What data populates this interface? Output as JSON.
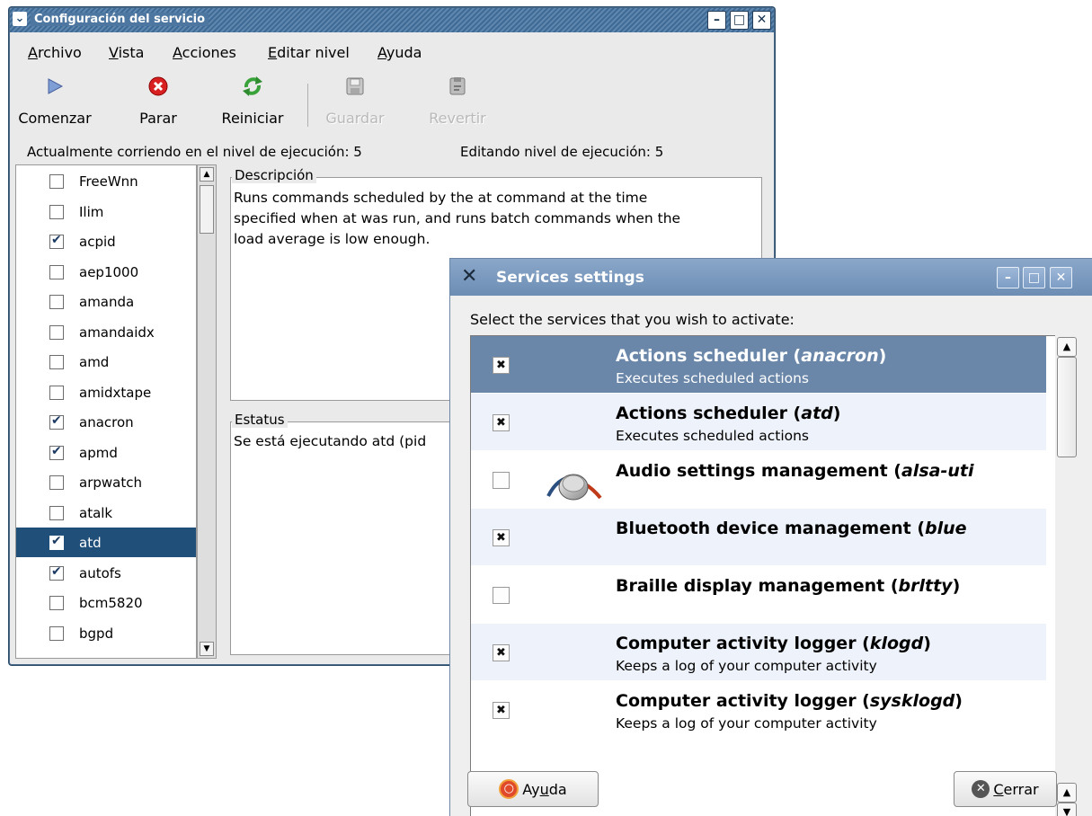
{
  "win1": {
    "title": "Configuración del servicio",
    "menu": [
      {
        "first": "A",
        "rest": "rchivo"
      },
      {
        "first": "V",
        "rest": "ista"
      },
      {
        "first": "A",
        "rest": "cciones"
      },
      {
        "first": "E",
        "rest": "ditar nivel"
      },
      {
        "first": "A",
        "rest": "yuda"
      }
    ],
    "toolbar": {
      "start": "Comenzar",
      "stop": "Parar",
      "restart": "Reiniciar",
      "save": "Guardar",
      "revert": "Revertir"
    },
    "status_current": "Actualmente corriendo en el nivel de ejecución: 5",
    "status_editing": "Editando nivel de ejecución: 5",
    "services": [
      {
        "name": "FreeWnn",
        "checked": false
      },
      {
        "name": "Ilim",
        "checked": false
      },
      {
        "name": "acpid",
        "checked": true
      },
      {
        "name": "aep1000",
        "checked": false
      },
      {
        "name": "amanda",
        "checked": false
      },
      {
        "name": "amandaidx",
        "checked": false
      },
      {
        "name": "amd",
        "checked": false
      },
      {
        "name": "amidxtape",
        "checked": false
      },
      {
        "name": "anacron",
        "checked": true
      },
      {
        "name": "apmd",
        "checked": true
      },
      {
        "name": "arpwatch",
        "checked": false
      },
      {
        "name": "atalk",
        "checked": false
      },
      {
        "name": "atd",
        "checked": true,
        "selected": true
      },
      {
        "name": "autofs",
        "checked": true
      },
      {
        "name": "bcm5820",
        "checked": false
      },
      {
        "name": "bgpd",
        "checked": false
      }
    ],
    "description_label": "Descripción",
    "description_lines": [
      "Runs commands scheduled by the at command at the time",
      "specified when at was run, and runs batch commands when the",
      "load average is low enough."
    ],
    "status_label": "Estatus",
    "status_text": "Se está ejecutando atd (pid"
  },
  "win2": {
    "title": "Services settings",
    "instruction": "Select the services that you wish to activate:",
    "rows": [
      {
        "title_prefix": "Actions scheduler (",
        "title_italic": "anacron",
        "title_suffix": ")",
        "subtitle": "Executes scheduled actions",
        "checked": true,
        "selected": true
      },
      {
        "title_prefix": "Actions scheduler (",
        "title_italic": "atd",
        "title_suffix": ")",
        "subtitle": "Executes scheduled actions",
        "checked": true
      },
      {
        "title_prefix": "Audio settings management (",
        "title_italic": "alsa-uti",
        "title_suffix": "",
        "subtitle": "",
        "checked": false,
        "icon": "audio-knob-icon"
      },
      {
        "title_prefix": "Bluetooth device management (",
        "title_italic": "blue",
        "title_suffix": "",
        "subtitle": "",
        "checked": true
      },
      {
        "title_prefix": "Braille display management (",
        "title_italic": "brltty",
        "title_suffix": ")",
        "subtitle": "",
        "checked": false
      },
      {
        "title_prefix": "Computer activity logger (",
        "title_italic": "klogd",
        "title_suffix": ")",
        "subtitle": "Keeps a log of your computer activity",
        "checked": true
      },
      {
        "title_prefix": "Computer activity logger (",
        "title_italic": "sysklogd",
        "title_suffix": ")",
        "subtitle": "Keeps a log of your computer activity",
        "checked": true
      }
    ],
    "help_pre": "Ay",
    "help_u": "u",
    "help_post": "da",
    "close_u": "C",
    "close_post": "errar"
  }
}
